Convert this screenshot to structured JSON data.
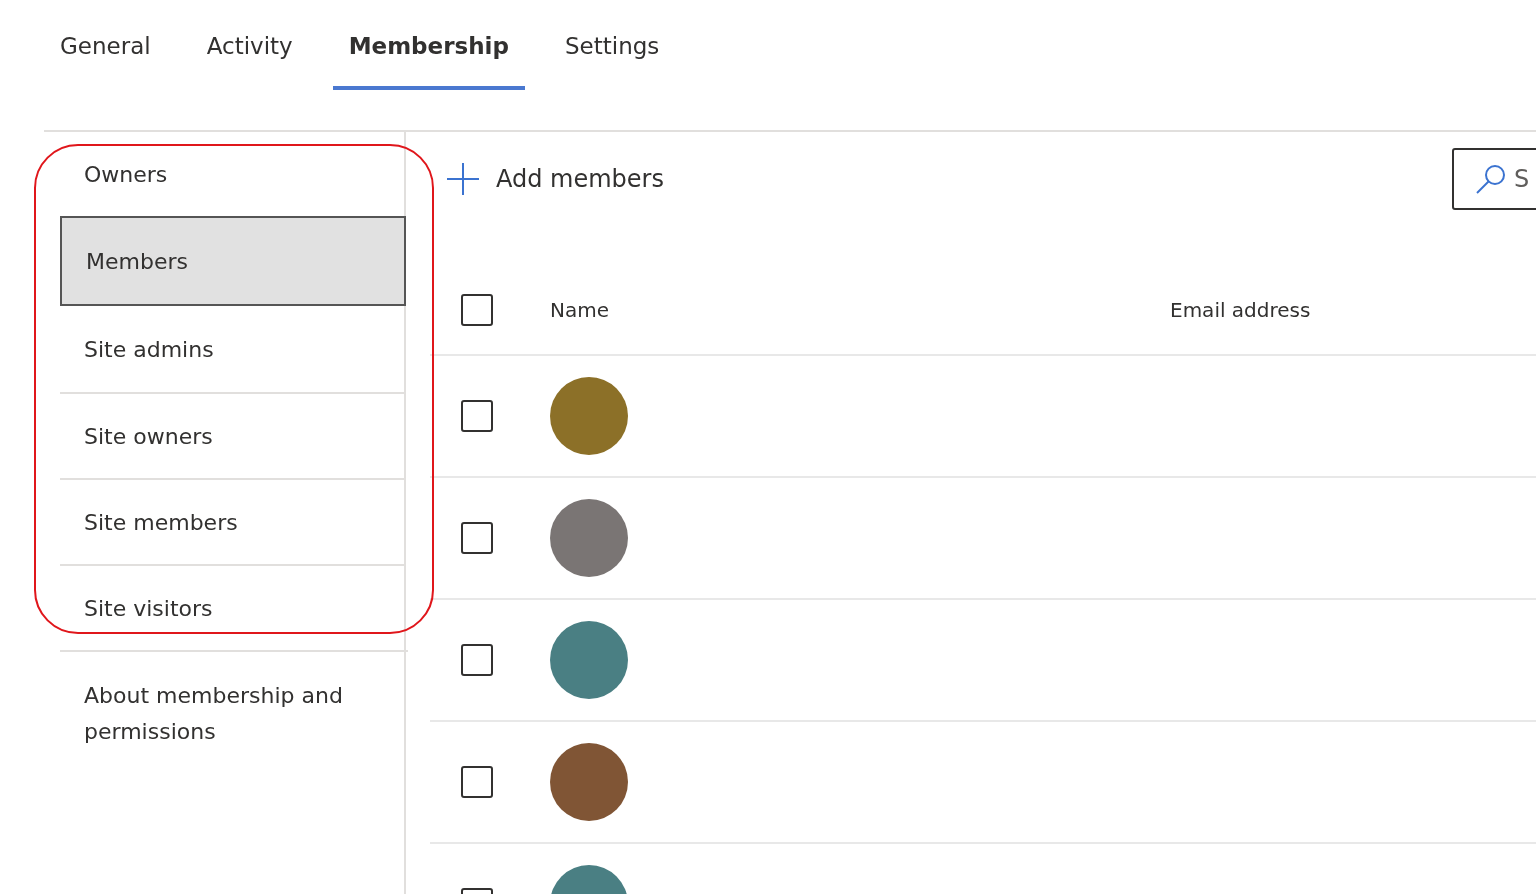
{
  "tabs": [
    {
      "label": "General",
      "selected": false
    },
    {
      "label": "Activity",
      "selected": false
    },
    {
      "label": "Membership",
      "selected": true
    },
    {
      "label": "Settings",
      "selected": false
    }
  ],
  "sidebar": {
    "items": [
      {
        "label": "Owners",
        "selected": false
      },
      {
        "label": "Members",
        "selected": true
      },
      {
        "label": "Site admins",
        "selected": false
      },
      {
        "label": "Site owners",
        "selected": false
      },
      {
        "label": "Site members",
        "selected": false
      },
      {
        "label": "Site visitors",
        "selected": false
      }
    ],
    "outline_annotation": true,
    "about_link": "About membership and permissions"
  },
  "toolbar": {
    "add_button": "Add members",
    "search": {
      "placeholder": "S"
    }
  },
  "table": {
    "select_all_checked": false,
    "columns": [
      "Name",
      "Email address"
    ],
    "rows": [
      {
        "checked": false,
        "color": "#8c7028"
      },
      {
        "checked": false,
        "color": "#7a7574"
      },
      {
        "checked": false,
        "color": "#4a7f83"
      },
      {
        "checked": false,
        "color": "#805535"
      },
      {
        "checked": false,
        "color": "#4a7f83"
      }
    ]
  }
}
